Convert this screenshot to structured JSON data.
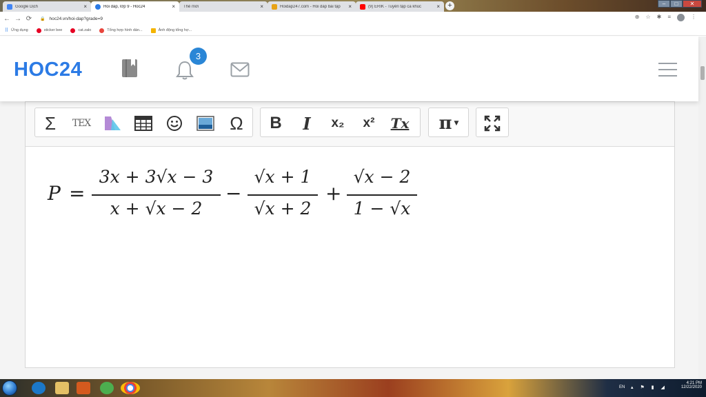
{
  "browser": {
    "tabs": [
      {
        "label": "Google Dịch",
        "active": false,
        "favicon_color": "#4285f4"
      },
      {
        "label": "Hỏi đáp, lớp 9 - Hoc24",
        "active": true,
        "favicon_color": "#2c7be5"
      },
      {
        "label": "Thẻ mới",
        "active": false,
        "favicon_color": "#dfe1e5"
      },
      {
        "label": "Hoidap247.com - Hỏi đáp bài tập",
        "active": false,
        "favicon_color": "#e8a317"
      },
      {
        "label": "(9) ERIK - Tuyển tập ca khúc",
        "active": false,
        "favicon_color": "#ff0000"
      }
    ],
    "close_glyph": "×",
    "newtab_glyph": "+",
    "url": "hoc24.vn/hoi-dap?grade=9",
    "bookmarks": [
      {
        "label": "Ứng dụng",
        "color": "#5f6368"
      },
      {
        "label": "sticker bee",
        "color": "#e60023"
      },
      {
        "label": "cat.zalo",
        "color": "#e60023"
      },
      {
        "label": "Tổng hợp hình dán...",
        "color": "#e8453c"
      },
      {
        "label": "Ảnh động tổng hợ...",
        "color": "#f4b400"
      }
    ]
  },
  "site": {
    "logo": "HOC24",
    "brand_color": "#2c7be5",
    "notification_count": "3"
  },
  "toolbar": {
    "tex_label": "TEX",
    "bold": "B",
    "italic": "I",
    "subscript": "x₂",
    "superscript": "x²",
    "clear_format": "Tx",
    "pi": "π"
  },
  "formula": {
    "lhs": "P",
    "equals": "=",
    "frac1": {
      "num": "3x + 3√x − 3",
      "den": "x + √x − 2"
    },
    "minus": "−",
    "frac2": {
      "num": "√x + 1",
      "den": "√x + 2"
    },
    "plus": "+",
    "frac3": {
      "num": "√x − 2",
      "den": "1 − √x"
    }
  },
  "taskbar": {
    "language": "EN",
    "time": "4:21 PM",
    "date": "12/22/2020"
  }
}
